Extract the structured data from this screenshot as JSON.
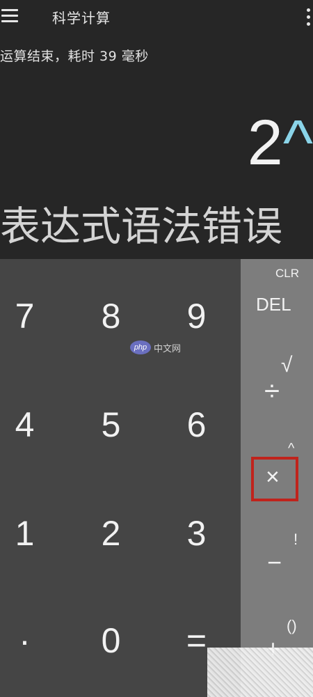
{
  "header": {
    "title": "科学计算",
    "menu_icon": "hamburger-menu-icon",
    "overflow_icon": "more-vertical-icon"
  },
  "status": {
    "text": "运算结束，耗时 39 毫秒"
  },
  "display": {
    "expression_number": "2",
    "expression_operator": "^",
    "result": "表达式语法错误"
  },
  "numpad": {
    "row1": [
      "7",
      "8",
      "9"
    ],
    "row2": [
      "4",
      "5",
      "6"
    ],
    "row3": [
      "1",
      "2",
      "3"
    ],
    "row4": [
      "·",
      "0",
      "="
    ]
  },
  "operators": {
    "clr": "CLR",
    "del": "DEL",
    "sqrt": "√",
    "divide": "÷",
    "power": "^",
    "multiply": "×",
    "factorial": "!",
    "minus": "−",
    "parens": "()",
    "plus": "+"
  },
  "watermark": {
    "logo": "php",
    "text": "中文网"
  },
  "colors": {
    "background": "#262626",
    "numpad": "#454545",
    "operator_pad": "#7d7d7d",
    "accent": "#8ad4e8",
    "highlight": "#c0231c"
  }
}
